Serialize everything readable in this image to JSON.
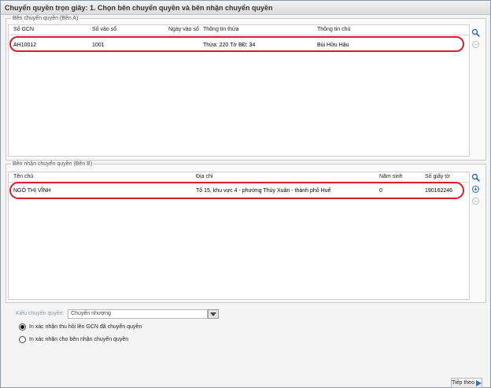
{
  "window": {
    "title": "Chuyển quyền trọn giây: 1. Chọn bên chuyển quyền và bên nhận chuyển quyền"
  },
  "side_a": {
    "legend": "Bên chuyển quyền (Bên A)",
    "columns": [
      "Số GCN",
      "Số vào sổ",
      "Ngày vào sổ",
      "Thông tin thửa",
      "Thông tin chủ"
    ],
    "rows": [
      {
        "so_gcn": "AH10012",
        "so_vao_so": "1001",
        "ngay_vao_so": "",
        "thong_tin_thua": "Thửa: 220 Tờ BĐ: 34",
        "thong_tin_chu": "Bùi Hữu Hậu"
      }
    ],
    "icons": [
      "search-icon",
      "remove-icon"
    ]
  },
  "side_b": {
    "legend": "Bên nhận chuyển quyền (Bên B)",
    "columns": [
      "Tên chủ",
      "Địa chỉ",
      "Năm sinh",
      "Số giấy tờ"
    ],
    "rows": [
      {
        "ten_chu": "NGÔ THỊ VĨNH",
        "dia_chi": "Tổ 15, khu vực 4 - phường Thủy Xuân - thành phố Huế",
        "nam_sinh": "0",
        "so_giay_to": "190162246"
      }
    ],
    "icons": [
      "search-icon",
      "add-icon",
      "remove-icon"
    ]
  },
  "options": {
    "kieu_label": "Kiểu chuyển quyền:",
    "kieu_value": "Chuyển nhượng",
    "radios": [
      {
        "label": "In xác nhận thu hồi lên GCN đã chuyển quyền",
        "checked": true
      },
      {
        "label": "In xác nhận cho bên nhận chuyển quyền",
        "checked": false
      }
    ]
  },
  "footer": {
    "next_label": "Tiếp theo"
  },
  "colors": {
    "highlight_ring": "#d8202a",
    "accent": "#1f6fc4"
  }
}
